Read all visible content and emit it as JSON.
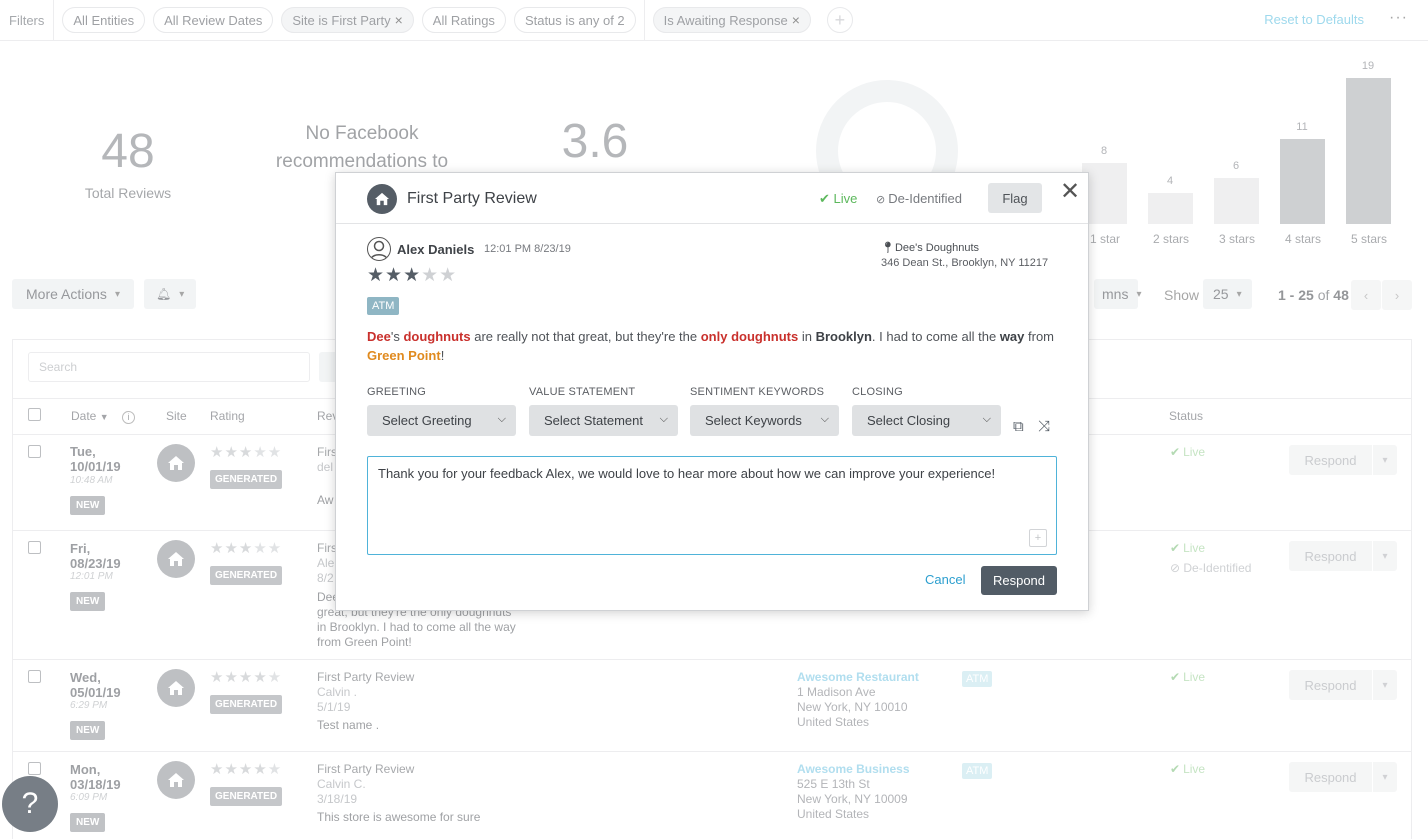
{
  "filters": {
    "label": "Filters",
    "chips": [
      {
        "label": "All Entities"
      },
      {
        "label": "All Review Dates"
      },
      {
        "label": "Site is First Party"
      },
      {
        "label": "All Ratings"
      },
      {
        "label": "Status is any of 2"
      },
      {
        "label": "Is Awaiting Response"
      }
    ],
    "reset_label": "Reset to Defaults",
    "more": "···"
  },
  "summary": {
    "total_reviews": "48",
    "total_reviews_label": "Total Reviews",
    "facebook_note": "No Facebook recommendations to",
    "average_rating": "3.6"
  },
  "rating_distribution": {
    "values": [
      8,
      4,
      6,
      11,
      19
    ],
    "labels": [
      "1 star",
      "2 stars",
      "3 stars",
      "4 stars",
      "5 stars"
    ]
  },
  "toolbar": {
    "more_actions": "More Actions",
    "columns_partial": "mns",
    "show_label": "Show",
    "page_size": "25",
    "range": "1 - 25",
    "of_label": "of",
    "total": "48"
  },
  "table": {
    "search_placeholder": "Search",
    "headers": {
      "date": "Date",
      "site": "Site",
      "rating": "Rating",
      "review": "Rev",
      "status": "Status"
    },
    "rows": [
      {
        "day": "Tue,",
        "date": "10/01/19",
        "time": "10:48 AM",
        "new": "NEW",
        "gen": "GENERATED",
        "title": "Firs",
        "sub": "del",
        "text": "Aw",
        "status": "Live",
        "respond": "Respond",
        "rating": 3
      },
      {
        "day": "Fri,",
        "date": "08/23/19",
        "time": "12:01 PM",
        "new": "NEW",
        "gen": "GENERATED",
        "title": "Firs",
        "sub": "Ale",
        "date2": "8/2",
        "text1": "Dee",
        "text2": "great, but they're the only doughnuts",
        "text3": "in Brooklyn. I had to come all the way",
        "text4": "from Green Point!",
        "status": "Live",
        "status2": "De-Identified",
        "respond": "Respond",
        "rating": 3
      },
      {
        "day": "Wed,",
        "date": "05/01/19",
        "time": "6:29 PM",
        "new": "NEW",
        "gen": "GENERATED",
        "title": "First Party Review",
        "sub": "Calvin .",
        "date2": "5/1/19",
        "text": "Test name .",
        "loc_name": "Awesome Restaurant",
        "addr1": "1 Madison Ave",
        "addr2": "New York, NY 10010",
        "addr3": "United States",
        "tag": "ATM",
        "status": "Live",
        "respond": "Respond",
        "rating": 4
      },
      {
        "day": "Mon,",
        "date": "03/18/19",
        "time": "6:09 PM",
        "new": "NEW",
        "gen": "GENERATED",
        "title": "First Party Review",
        "sub": "Calvin C.",
        "date2": "3/18/19",
        "text": "This store is awesome for sure",
        "loc_name": "Awesome Business",
        "addr1": "525 E 13th St",
        "addr2": "New York, NY 10009",
        "addr3": "United States",
        "tag": "ATM",
        "status": "Live",
        "respond": "Respond",
        "rating": 4
      }
    ]
  },
  "help": "?",
  "modal": {
    "title": "First Party Review",
    "live": "Live",
    "deidentified": "De-Identified",
    "flag": "Flag",
    "author": "Alex Daniels",
    "timestamp": "12:01 PM 8/23/19",
    "rating": 3,
    "location_name": "Dee's Doughnuts",
    "location_address": "346 Dean St., Brooklyn, NY 11217",
    "tag": "ATM",
    "review_parts": [
      "Dee",
      "'s ",
      "doughnuts",
      " are really not that great, but they're the ",
      "only doughnuts",
      " in ",
      "Brooklyn",
      ". I had to come all the ",
      "way",
      " from ",
      "Green Point",
      "!"
    ],
    "sections": [
      {
        "label": "GREETING",
        "value": "Select Greeting"
      },
      {
        "label": "VALUE STATEMENT",
        "value": "Select Statement"
      },
      {
        "label": "SENTIMENT KEYWORDS",
        "value": "Select Keywords"
      },
      {
        "label": "CLOSING",
        "value": "Select Closing"
      }
    ],
    "response_text": "Thank you for your feedback Alex, we would love to hear more about how we can improve your experience!",
    "cancel": "Cancel",
    "respond": "Respond"
  }
}
